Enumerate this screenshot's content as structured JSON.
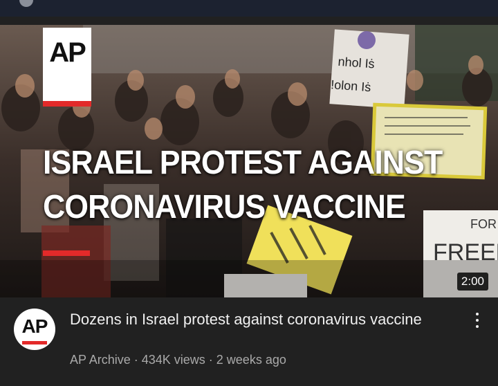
{
  "thumbnail": {
    "logo_text": "AP",
    "headline_line1": "ISRAEL PROTEST AGAINST",
    "headline_line2": "CORONAVIRUS VACCINE",
    "duration": "2:00"
  },
  "video": {
    "channel_avatar_text": "AP",
    "title": "Dozens in Israel protest against coronavirus vaccine",
    "channel": "AP Archive",
    "views": "434K views",
    "age": "2 weeks ago",
    "separator": " · "
  },
  "colors": {
    "background": "#212121",
    "accent_red": "#e32a2a",
    "title_text": "#f1f1f1",
    "meta_text": "#aaaaaa"
  },
  "icons": [
    "more-vert-icon"
  ]
}
